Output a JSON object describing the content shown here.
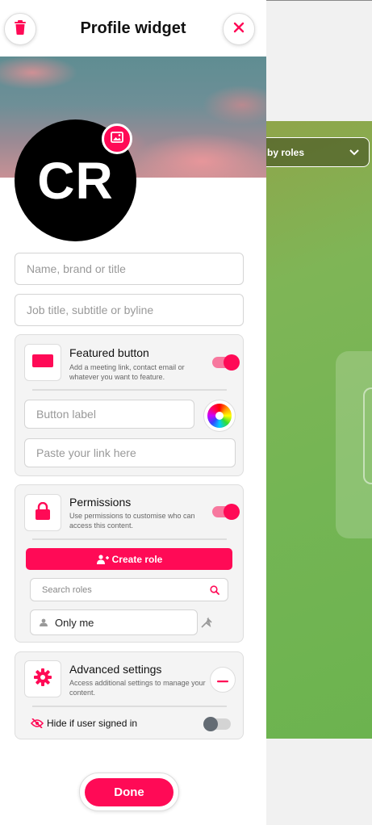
{
  "header": {
    "title": "Profile widget"
  },
  "avatar": {
    "initials": "CR"
  },
  "fields": {
    "name_placeholder": "Name, brand or title",
    "job_placeholder": "Job title, subtitle or byline"
  },
  "featured": {
    "title": "Featured button",
    "description": "Add a meeting link, contact email or whatever you want to feature.",
    "enabled": true,
    "button_label_placeholder": "Button label",
    "link_placeholder": "Paste your link here"
  },
  "permissions": {
    "title": "Permissions",
    "description": "Use permissions to customise who can access this content.",
    "enabled": true,
    "create_role_label": "Create role",
    "search_placeholder": "Search roles",
    "selected_role": "Only me"
  },
  "advanced": {
    "title": "Advanced settings",
    "description": "Access additional settings to manage your content.",
    "hide_if_signed_in_label": "Hide if user signed in",
    "hide_if_signed_in": false
  },
  "footer": {
    "done_label": "Done"
  },
  "background": {
    "filter_label": "by roles"
  },
  "colors": {
    "accent": "#ff0a56",
    "accent_light": "#f7789e",
    "toggle_off": "#636b73"
  }
}
